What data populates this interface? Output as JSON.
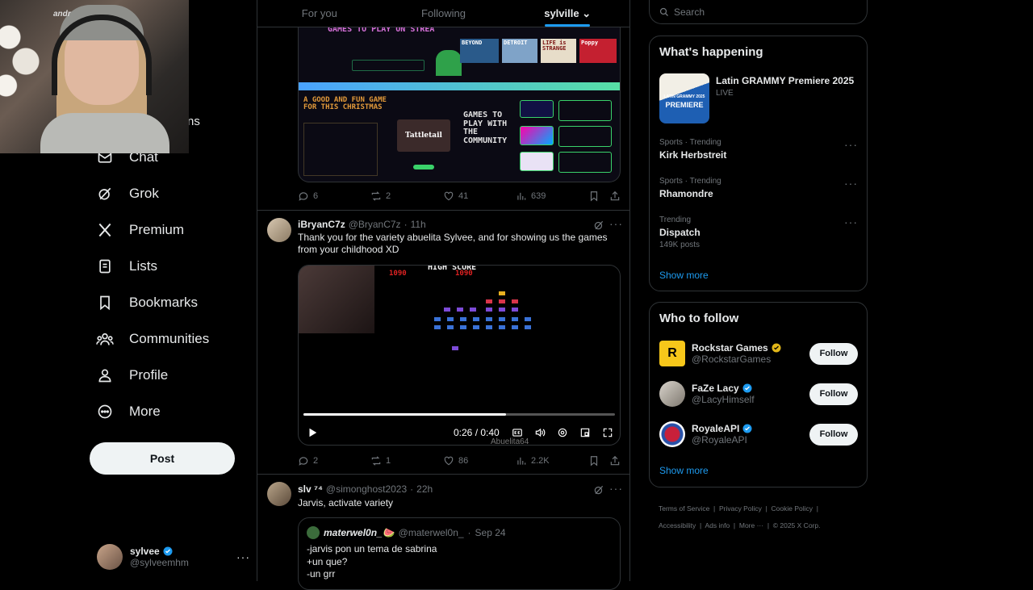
{
  "nav": {
    "partial_label": "ns",
    "items": [
      {
        "label": "Chat",
        "icon": "chat-icon"
      },
      {
        "label": "Grok",
        "icon": "grok-icon"
      },
      {
        "label": "Premium",
        "icon": "x-logo-icon"
      },
      {
        "label": "Lists",
        "icon": "lists-icon"
      },
      {
        "label": "Bookmarks",
        "icon": "bookmark-icon"
      },
      {
        "label": "Communities",
        "icon": "communities-icon"
      },
      {
        "label": "Profile",
        "icon": "profile-icon"
      },
      {
        "label": "More",
        "icon": "more-circle-icon"
      }
    ],
    "post_label": "Post",
    "account": {
      "name": "sylvee",
      "handle": "@sylveemhm"
    }
  },
  "webcam": {
    "overlay_text": "andr"
  },
  "feed": {
    "tabs": [
      {
        "label": "For you"
      },
      {
        "label": "Following"
      },
      {
        "label": "sylville"
      }
    ],
    "post1": {
      "collage": {
        "title1": "GAMES TO PLAY ON STREA",
        "title2": "A GOOD AND FUN GAME FOR THIS CHRISTMAS",
        "title3": "GAMES TO PLAY WITH THE COMMUNITY",
        "thumbs": [
          "BEYOND",
          "DETROIT",
          "LIFE is STRANGE",
          "Poppy"
        ],
        "game_logo": "Tattletail"
      },
      "stats": {
        "replies": "6",
        "reposts": "2",
        "likes": "41",
        "views": "639"
      }
    },
    "post2": {
      "name": "iBryanC7z",
      "handle": "@BryanC7z",
      "time": "11h",
      "text": "Thank you for the variety abuelita Sylvee, and for showing us the games from your childhood XD",
      "video": {
        "score_label": "HIGH SCORE",
        "score_left": "1090",
        "score_right": "1090",
        "time_current": "0:26",
        "time_total": "0:40",
        "progress": 0.65,
        "watermark": "Abuelita64"
      },
      "stats": {
        "replies": "2",
        "reposts": "1",
        "likes": "86",
        "views": "2.2K"
      }
    },
    "post3": {
      "name": "slv ⁷⁴",
      "handle": "@simonghost2023",
      "time": "22h",
      "text": "Jarvis, activate variety",
      "quote": {
        "name": "materwel0n_🍉",
        "handle": "@materwel0n_",
        "date": "Sep 24",
        "lines": [
          "-jarvis pon un tema de sabrina",
          "+un que?",
          "-un grr"
        ]
      }
    }
  },
  "search": {
    "placeholder": "Search"
  },
  "happening": {
    "title": "What's happening",
    "featured": {
      "title": "Latin GRAMMY Premiere 2025",
      "status": "LIVE",
      "thumb_text1": "LATIN GRAMMY 2025",
      "thumb_text2": "PREMIERE"
    },
    "trends": [
      {
        "context": "Sports · Trending",
        "name": "Kirk Herbstreit",
        "posts": ""
      },
      {
        "context": "Sports · Trending",
        "name": "Rhamondre",
        "posts": ""
      },
      {
        "context": "Trending",
        "name": "Dispatch",
        "posts": "149K posts"
      }
    ],
    "show_more": "Show more"
  },
  "who_to_follow": {
    "title": "Who to follow",
    "accounts": [
      {
        "name": "Rockstar Games",
        "handle": "@RockstarGames",
        "badge_color": "#e2b719"
      },
      {
        "name": "FaZe Lacy",
        "handle": "@LacyHimself",
        "badge_color": "#1d9bf0"
      },
      {
        "name": "RoyaleAPI",
        "handle": "@RoyaleAPI",
        "badge_color": "#1d9bf0"
      }
    ],
    "follow_label": "Follow",
    "show_more": "Show more"
  },
  "footer": {
    "links": [
      "Terms of Service",
      "Privacy Policy",
      "Cookie Policy",
      "Accessibility",
      "Ads info",
      "More ···",
      "© 2025 X Corp."
    ]
  },
  "colors": {
    "accent": "#1d9bf0",
    "border": "#2f3336",
    "muted": "#71767b"
  }
}
